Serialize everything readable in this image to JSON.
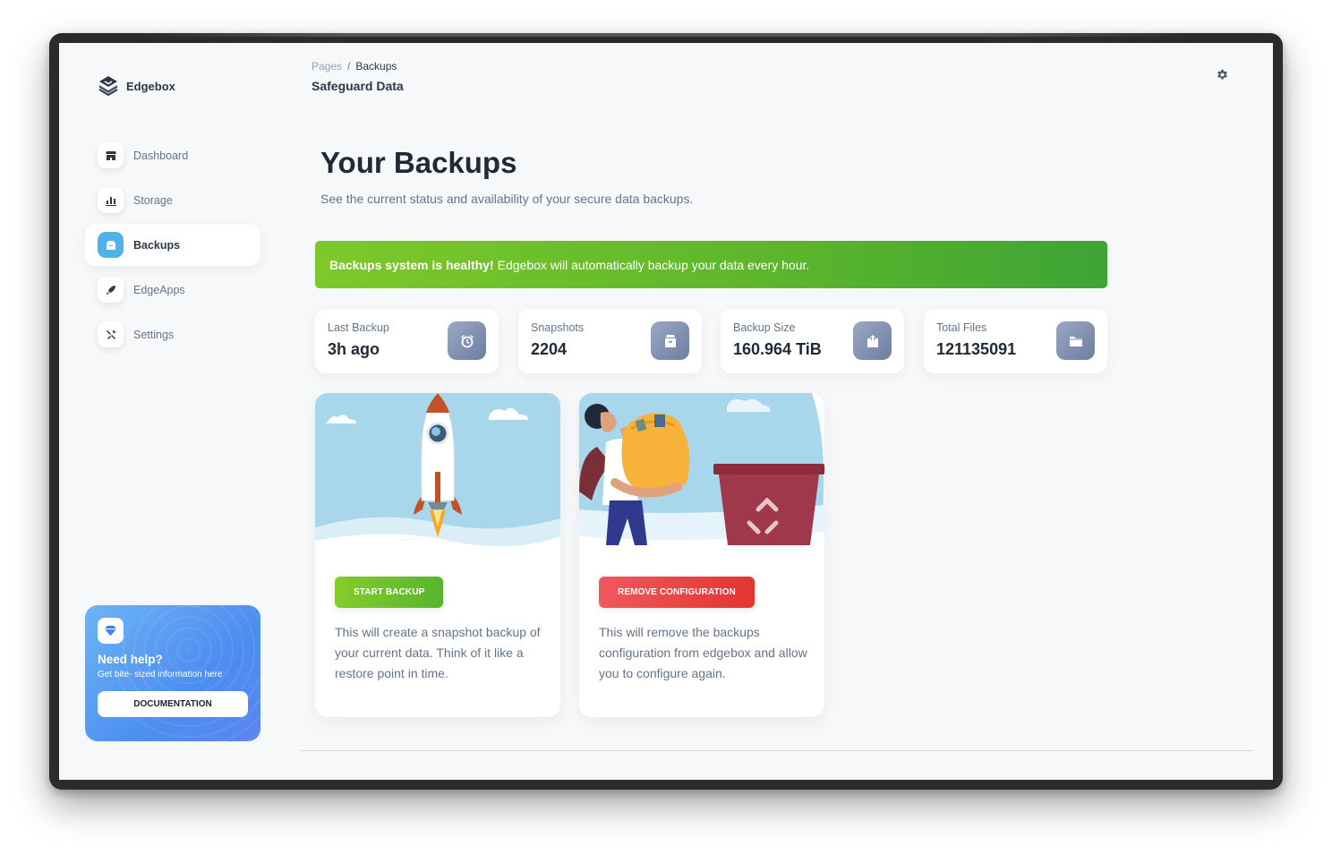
{
  "brand": {
    "name": "Edgebox"
  },
  "sidebar": {
    "items": [
      {
        "label": "Dashboard",
        "icon": "store-icon",
        "active": false
      },
      {
        "label": "Storage",
        "icon": "bar-chart-icon",
        "active": false
      },
      {
        "label": "Backups",
        "icon": "archive-icon",
        "active": true
      },
      {
        "label": "EdgeApps",
        "icon": "rocket-icon",
        "active": false
      },
      {
        "label": "Settings",
        "icon": "tools-icon",
        "active": false
      }
    ]
  },
  "help": {
    "title": "Need help?",
    "subtitle": "Get bite- sized information here",
    "button_label": "DOCUMENTATION",
    "icon": "diamond-icon"
  },
  "header": {
    "breadcrumb_root": "Pages",
    "breadcrumb_separator": "/",
    "breadcrumb_current": "Backups",
    "title": "Safeguard Data",
    "settings_icon": "gear-icon"
  },
  "main": {
    "title": "Your Backups",
    "subtitle": "See the current status and availability of your secure data backups."
  },
  "alert": {
    "bold": "Backups system is healthy!",
    "text": "Edgebox will automatically backup your data every hour.",
    "color": "#5bb52c"
  },
  "stats": [
    {
      "label": "Last Backup",
      "value": "3h ago",
      "icon": "alarm-clock-icon"
    },
    {
      "label": "Snapshots",
      "value": "2204",
      "icon": "archive-box-icon"
    },
    {
      "label": "Backup Size",
      "value": "160.964 TiB",
      "icon": "box-upload-icon"
    },
    {
      "label": "Total Files",
      "value": "121135091",
      "icon": "folder-icon"
    }
  ],
  "cards": [
    {
      "button": "START BACKUP",
      "text": "This will create a snapshot backup of your current data. Think of it like a restore point in time.",
      "illustration": "rocket-launch-illustration"
    },
    {
      "button": "REMOVE CONFIGURATION",
      "text": "This will remove the backups configuration from edgebox and allow you to configure again.",
      "illustration": "recycle-bin-illustration"
    }
  ],
  "colors": {
    "accent_blue": "#4fb3e8",
    "success_green": "#5bb52c",
    "danger_red": "#e3352f"
  }
}
